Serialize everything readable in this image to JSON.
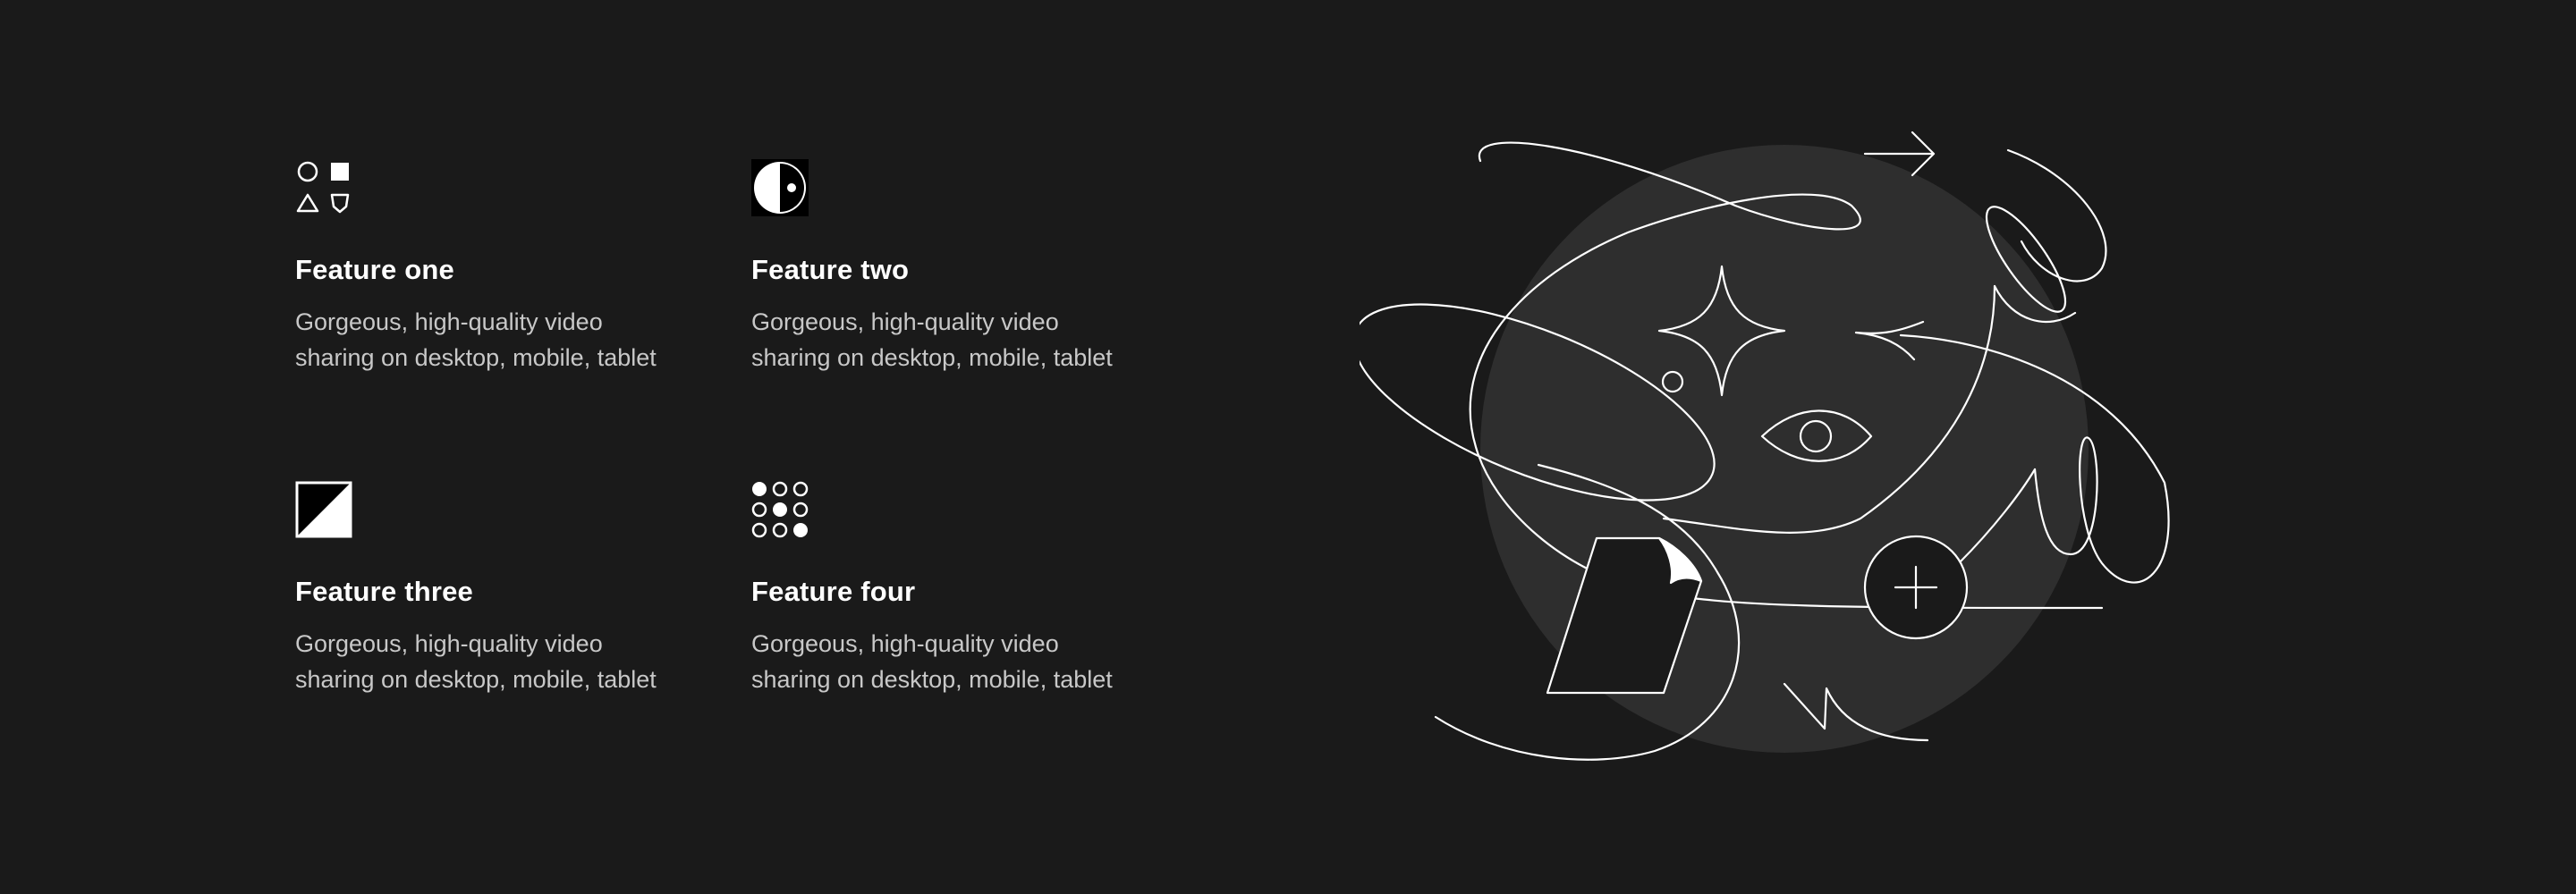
{
  "features": [
    {
      "title": "Feature one",
      "description": "Gorgeous, high-quality video sharing on desktop, mobile, tablet",
      "icon": "shapes-icon"
    },
    {
      "title": "Feature two",
      "description": "Gorgeous, high-quality video sharing on desktop, mobile, tablet",
      "icon": "half-circle-icon"
    },
    {
      "title": "Feature three",
      "description": "Gorgeous, high-quality video sharing on desktop, mobile, tablet",
      "icon": "diagonal-square-icon"
    },
    {
      "title": "Feature four",
      "description": "Gorgeous, high-quality video sharing on desktop, mobile, tablet",
      "icon": "dot-grid-icon"
    }
  ],
  "colors": {
    "background": "#1a1a1a",
    "text": "#ffffff",
    "muted_text": "#c8c8c8",
    "illustration_circle": "#2e2e2e"
  }
}
